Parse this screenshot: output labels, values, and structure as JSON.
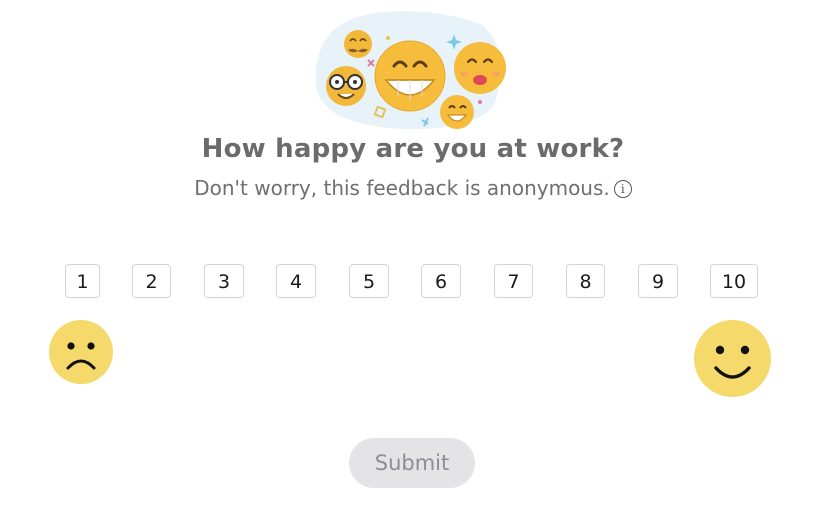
{
  "survey": {
    "title": "How happy are you at work?",
    "subtitle": "Don't worry, this feedback is anonymous.",
    "info_icon": "info-circle-icon",
    "scale": [
      "1",
      "2",
      "3",
      "4",
      "5",
      "6",
      "7",
      "8",
      "9",
      "10"
    ],
    "low_icon": "sad-face-icon",
    "high_icon": "smiley-face-icon",
    "submit_label": "Submit",
    "colors": {
      "face_yellow": "#f5d96b",
      "title_gray": "#6b6b6b",
      "submit_bg": "#e4e4e7",
      "submit_text": "#8d8d95"
    }
  }
}
